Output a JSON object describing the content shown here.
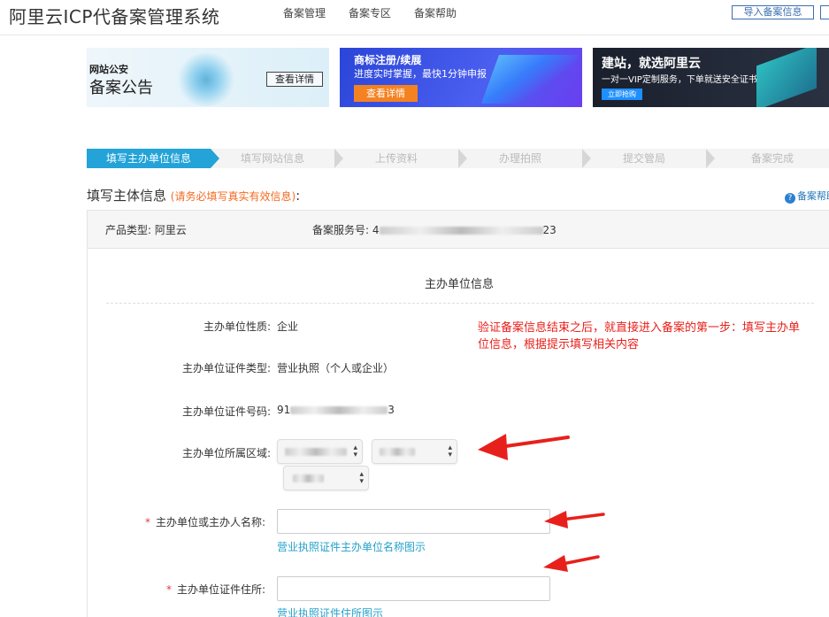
{
  "header": {
    "app_title": "阿里云ICP代备案管理系统",
    "nav": [
      "备案管理",
      "备案专区",
      "备案帮助"
    ],
    "import_button": "导入备案信息"
  },
  "banners": {
    "b1_small": "网站公安",
    "b1_big": "备案公告",
    "b1_button": "查看详情",
    "b2_title": "商标注册/续展",
    "b2_sub": "进度实时掌握，最快1分钟申报",
    "b2_button": "查看详情",
    "b3_title": "建站，就选阿里云",
    "b3_sub": "一对一VIP定制服务，下单就送安全证书",
    "b3_button": "立即抢购"
  },
  "steps": [
    "填写主办单位信息",
    "填写网站信息",
    "上传资料",
    "办理拍照",
    "提交管局",
    "备案完成"
  ],
  "section": {
    "title": "填写主体信息",
    "note": "(请务必填写真实有效信息)",
    "colon": ":",
    "help": "备案帮助"
  },
  "info": {
    "product_label": "产品类型:",
    "product_value": "阿里云",
    "service_label": "备案服务号:",
    "service_value_start": "4",
    "service_value_end": "23"
  },
  "form": {
    "header": "主办单位信息",
    "nature_label": "主办单位性质:",
    "nature_value": "企业",
    "cert_type_label": "主办单位证件类型:",
    "cert_type_value": "营业执照（个人或企业）",
    "cert_no_label": "主办单位证件号码:",
    "cert_no_start": "91",
    "cert_no_end": "3",
    "region_label": "主办单位所属区域:",
    "name_label": "主办单位或主办人名称:",
    "name_value": "",
    "name_sample": "营业执照证件主办单位名称图示",
    "address_label": "主办单位证件住所:",
    "address_value": "",
    "address_sample": "营业执照证件住所图示",
    "required_mark": "*"
  },
  "annotation": "验证备案信息结束之后，就直接进入备案的第一步：填写主办单位信息，根据提示填写相关内容",
  "colors": {
    "accent": "#23a3d8",
    "note_orange": "#f26b22",
    "annotation_red": "#e8201b",
    "link": "#24a0c9"
  }
}
